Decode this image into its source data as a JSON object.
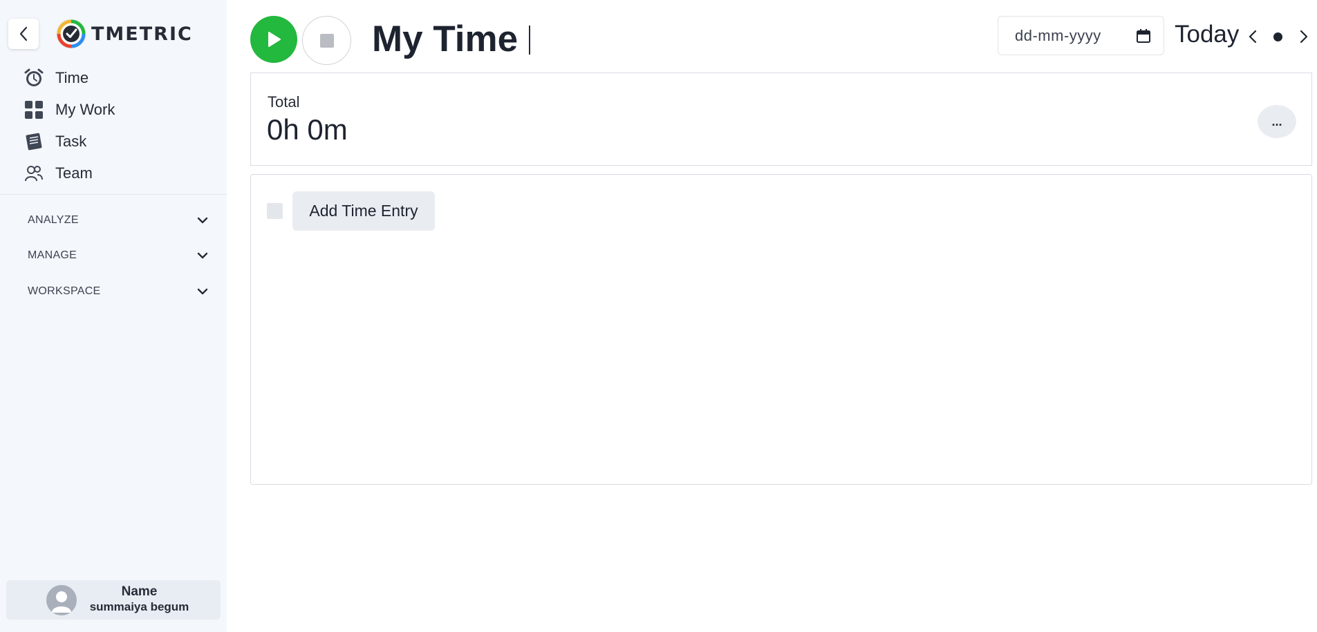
{
  "app": {
    "logo_text": "TMETRIC",
    "brand_colors": {
      "green": "#23b83e",
      "red": "#e8432e",
      "blue": "#2d8ef0",
      "dark": "#262b36"
    }
  },
  "sidebar": {
    "collapse_icon": "chevron-left-icon",
    "items": [
      {
        "label": "Time",
        "icon": "alarm-clock-icon"
      },
      {
        "label": "My Work",
        "icon": "grid-icon"
      },
      {
        "label": "Task",
        "icon": "notebook-icon"
      },
      {
        "label": "Team",
        "icon": "team-icon"
      }
    ],
    "sections": [
      {
        "label": "ANALYZE",
        "icon": "chevron-down-icon"
      },
      {
        "label": "MANAGE",
        "icon": "chevron-down-icon"
      },
      {
        "label": "WORKSPACE",
        "icon": "chevron-down-icon"
      }
    ],
    "user": {
      "name_label": "Name",
      "name": "summaiya begum",
      "icon": "user-avatar-icon"
    }
  },
  "header": {
    "title": "My Time",
    "date_placeholder": "dd-mm-yyyy",
    "today_label": "Today",
    "prev_label": "<",
    "next_label": ">"
  },
  "summary": {
    "total_label": "Total",
    "total_value": "0h 0m",
    "more_label": "..."
  },
  "entries": {
    "add_label": "Add Time Entry"
  }
}
